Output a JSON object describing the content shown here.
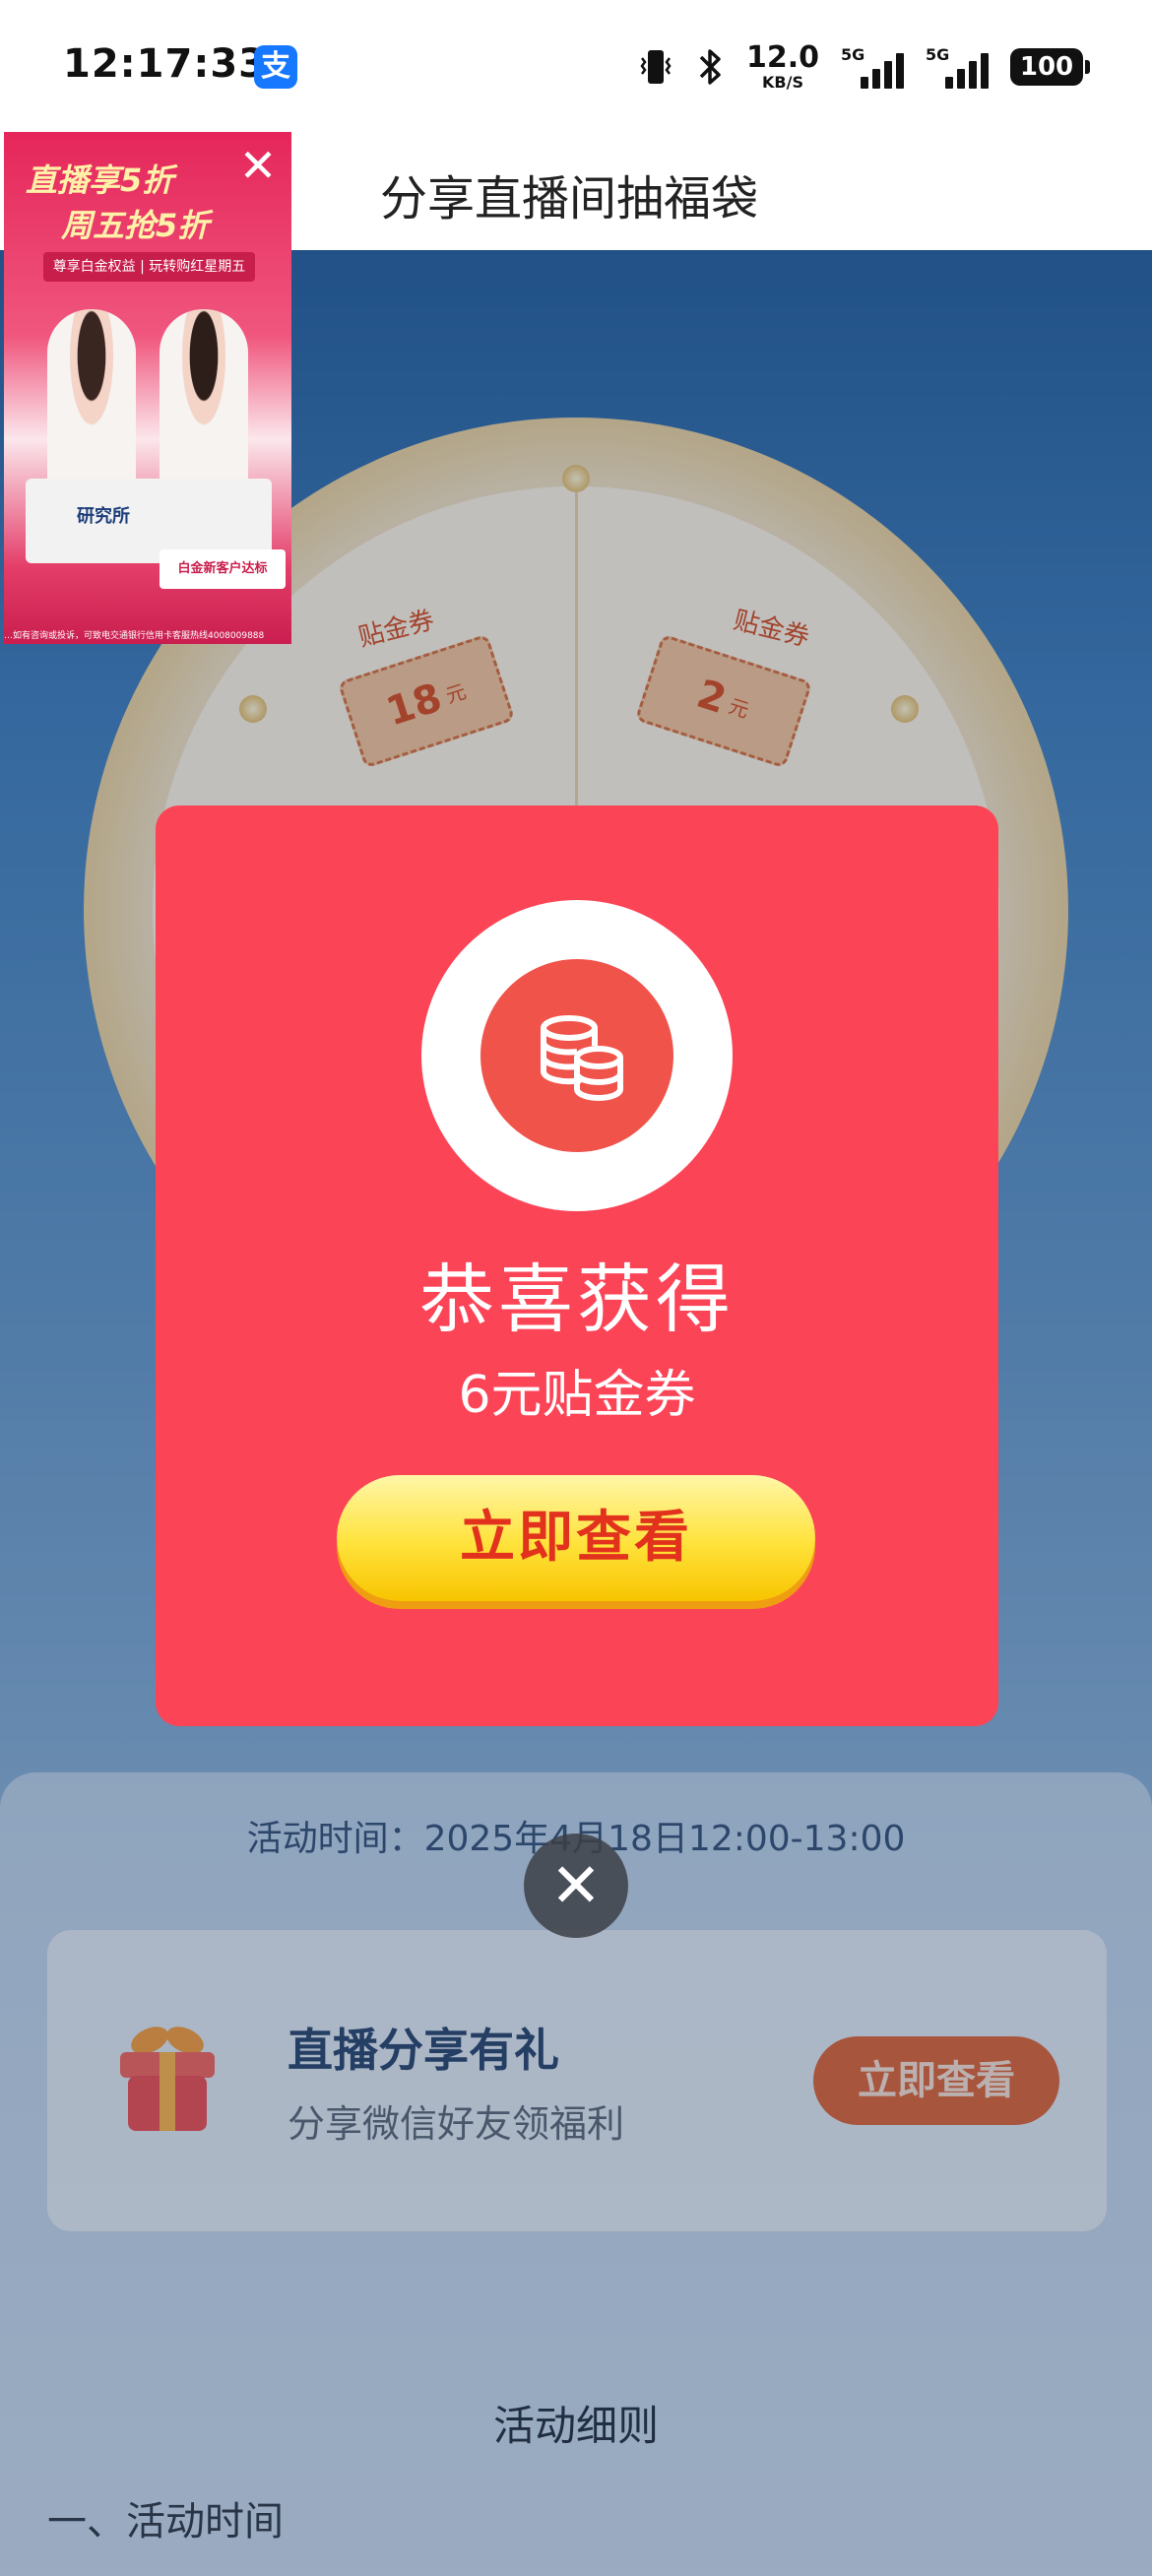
{
  "status_bar": {
    "time": "12:17:33",
    "app_icon": "支",
    "speed_value": "12.0",
    "speed_unit": "KB/S",
    "signal_1": "5G",
    "signal_2": "5G",
    "battery": "100"
  },
  "header": {
    "title": "分享直播间抽福袋"
  },
  "video": {
    "headline_1": "直播享5折",
    "headline_2": "周五抢5折",
    "tag": "尊享白金权益 | 玩转购红星期五",
    "desk_text": "研究所",
    "bottom_badge": "白金新客户达标",
    "disclaimer": "…如有咨询或投诉，可致电交通银行信用卡客服热线4008009888"
  },
  "wheel": {
    "left_label": "贴金券",
    "left_amount": "18",
    "right_label": "贴金券",
    "right_amount": "2",
    "unit": "元"
  },
  "modal": {
    "title": "恭喜获得",
    "prize": "6元贴金券",
    "button": "立即查看"
  },
  "activity_time": "活动时间：2025年4月18日12:00-13:00",
  "share_card": {
    "title": "直播分享有礼",
    "subtitle": "分享微信好友领福利",
    "button": "立即查看"
  },
  "rules": {
    "title": "活动细则",
    "section_1": "一、活动时间"
  },
  "icons": {
    "close": "✕",
    "video_close": "✕"
  },
  "colors": {
    "modal_bg": "#fc4457",
    "button_yellow": "#ffe23a",
    "button_text": "#e2321d"
  }
}
